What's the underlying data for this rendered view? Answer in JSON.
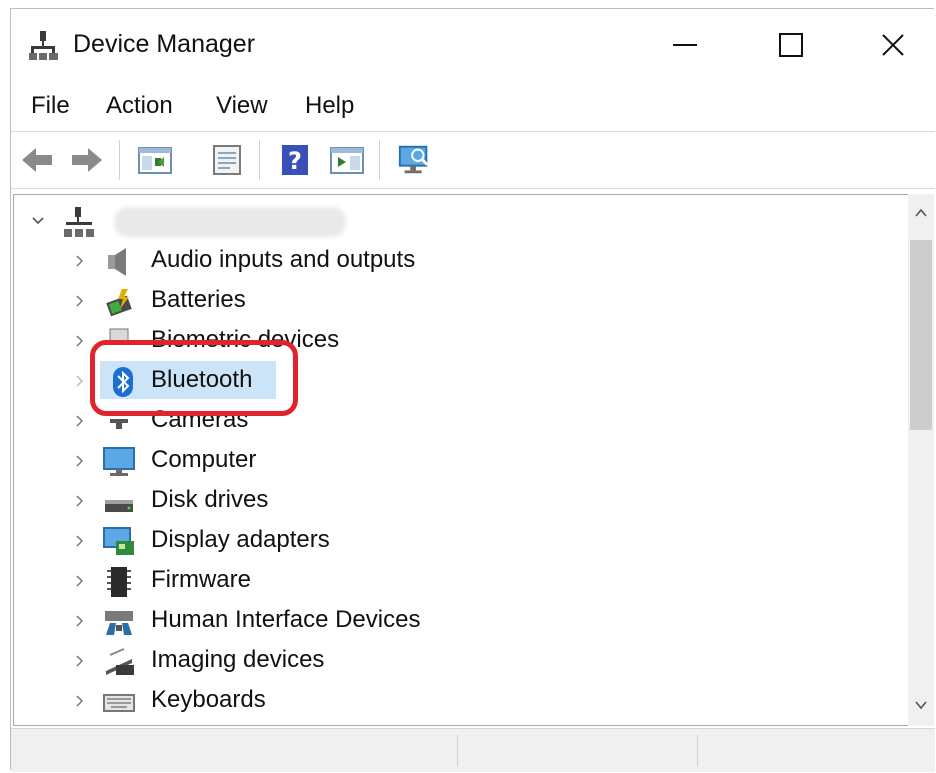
{
  "window": {
    "title": "Device Manager"
  },
  "title_buttons": {
    "minimize": "minimize-icon",
    "maximize": "maximize-icon",
    "close": "close-icon"
  },
  "menu": {
    "file": "File",
    "action": "Action",
    "view": "View",
    "help": "Help"
  },
  "toolbar": [
    "back-icon",
    "forward-icon",
    "show-hide-console-tree-icon",
    "properties-icon",
    "help-icon",
    "run-action-icon",
    "scan-hardware-icon"
  ],
  "tree": {
    "root": {
      "expanded": true,
      "label_obscured": true
    },
    "items": [
      {
        "label": "Audio inputs and outputs",
        "icon": "speaker-icon"
      },
      {
        "label": "Batteries",
        "icon": "battery-icon"
      },
      {
        "label": "Biometric devices",
        "icon": "biometric-icon",
        "obscured": true
      },
      {
        "label": "Bluetooth",
        "icon": "bluetooth-icon",
        "selected": true,
        "highlighted": true
      },
      {
        "label": "Cameras",
        "icon": "camera-icon",
        "obscured": true
      },
      {
        "label": "Computer",
        "icon": "monitor-icon"
      },
      {
        "label": "Disk drives",
        "icon": "disk-drive-icon"
      },
      {
        "label": "Display adapters",
        "icon": "display-adapter-icon"
      },
      {
        "label": "Firmware",
        "icon": "firmware-chip-icon"
      },
      {
        "label": "Human Interface Devices",
        "icon": "hid-icon"
      },
      {
        "label": "Imaging devices",
        "icon": "imaging-icon"
      },
      {
        "label": "Keyboards",
        "icon": "keyboard-icon"
      }
    ]
  },
  "colors": {
    "selection": "#cce4f7",
    "highlight_ring": "#e0242b",
    "bluetooth": "#1c6fd1"
  }
}
